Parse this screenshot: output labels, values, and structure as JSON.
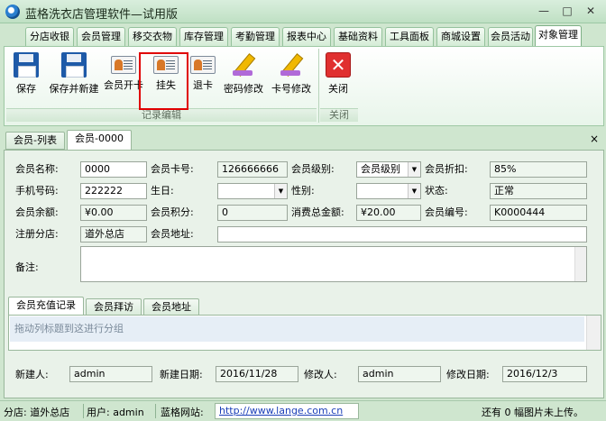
{
  "window": {
    "title": "蓝格洗衣店管理软件—试用版",
    "controls": {
      "minimize": "—",
      "maximize": "□",
      "close": "✕"
    }
  },
  "menu_tabs": [
    "分店收银",
    "会员管理",
    "移交衣物",
    "库存管理",
    "考勤管理",
    "报表中心",
    "基础资料",
    "工具面板",
    "商城设置",
    "会员活动",
    "对象管理"
  ],
  "ribbon": {
    "buttons": {
      "save": "保存",
      "save_new": "保存并新建",
      "open_card": "会员开卡",
      "report_loss": "挂失",
      "return_card": "退卡",
      "change_password": "密码修改",
      "change_card_no": "卡号修改",
      "close": "关闭"
    },
    "groups": {
      "record_edit": "记录编辑",
      "close": "关闭"
    }
  },
  "doc_tabs": [
    "会员-列表",
    "会员-0000"
  ],
  "doc_close": "×",
  "form": {
    "labels": {
      "member_name": "会员名称:",
      "card_no": "会员卡号:",
      "level": "会员级别:",
      "discount": "会员折扣:",
      "phone": "手机号码:",
      "birthday": "生日:",
      "gender": "性别:",
      "status": "状态:",
      "balance": "会员余额:",
      "points": "会员积分:",
      "total_spent": "消费总金额:",
      "member_id": "会员编号:",
      "branch": "注册分店:",
      "address": "会员地址:",
      "remark": "备注:"
    },
    "values": {
      "member_name": "0000",
      "card_no": "126666666",
      "level": "会员级别",
      "discount": "85%",
      "phone": "222222",
      "birthday": "",
      "gender": "",
      "status": "正常",
      "balance": "¥0.00",
      "points": "0",
      "total_spent": "¥20.00",
      "member_id": "K0000444",
      "branch": "道外总店",
      "address": "",
      "remark": ""
    }
  },
  "sub_tabs": [
    "会员充值记录",
    "会员拜访",
    "会员地址"
  ],
  "grid": {
    "group_hint": "拖动列标题到这进行分组"
  },
  "footer": {
    "labels": {
      "creator": "新建人:",
      "created_date": "新建日期:",
      "modifier": "修改人:",
      "modified_date": "修改日期:"
    },
    "values": {
      "creator": "admin",
      "created_date": "2016/11/28",
      "modifier": "admin",
      "modified_date": "2016/12/3"
    }
  },
  "statusbar": {
    "branch": "分店: 道外总店",
    "user": "用户: admin",
    "website_label": "蓝格网站:",
    "website_url": "http://www.lange.com.cn",
    "pending": "还有 0 幅图片未上传。"
  }
}
